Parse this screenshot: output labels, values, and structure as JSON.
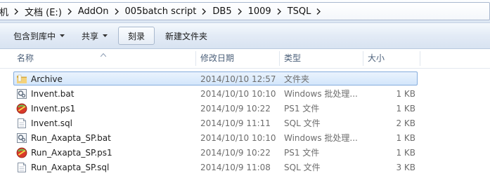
{
  "address": {
    "crumbs": [
      "机",
      "文档 (E:)",
      "AddOn",
      "005batch script",
      "DB5",
      "1009",
      "TSQL"
    ]
  },
  "toolbar": {
    "include_label": "包含到库中",
    "share_label": "共享",
    "burn_label": "刻录",
    "new_folder_label": "新建文件夹"
  },
  "columns": {
    "name": "名称",
    "date": "修改日期",
    "type": "类型",
    "size": "大小"
  },
  "files": [
    {
      "name": "Archive",
      "date": "2014/10/10 12:57",
      "type": "文件夹",
      "size": "",
      "icon": "folder-icon",
      "selected": true
    },
    {
      "name": "Invent.bat",
      "date": "2014/10/10 10:10",
      "type": "Windows 批处理...",
      "size": "1 KB",
      "icon": "batch-file-icon",
      "selected": false
    },
    {
      "name": "Invent.ps1",
      "date": "2014/10/9 10:22",
      "type": "PS1 文件",
      "size": "1 KB",
      "icon": "ps1-file-icon",
      "selected": false
    },
    {
      "name": "Invent.sql",
      "date": "2014/10/9 11:11",
      "type": "SQL 文件",
      "size": "2 KB",
      "icon": "sql-file-icon",
      "selected": false
    },
    {
      "name": "Run_Axapta_SP.bat",
      "date": "2014/10/10 10:10",
      "type": "Windows 批处理...",
      "size": "1 KB",
      "icon": "batch-file-icon",
      "selected": false
    },
    {
      "name": "Run_Axapta_SP.ps1",
      "date": "2014/10/9 10:22",
      "type": "PS1 文件",
      "size": "1 KB",
      "icon": "ps1-file-icon",
      "selected": false
    },
    {
      "name": "Run_Axapta_SP.sql",
      "date": "2014/10/9 11:08",
      "type": "SQL 文件",
      "size": "3 KB",
      "icon": "sql-file-icon",
      "selected": false
    }
  ]
}
